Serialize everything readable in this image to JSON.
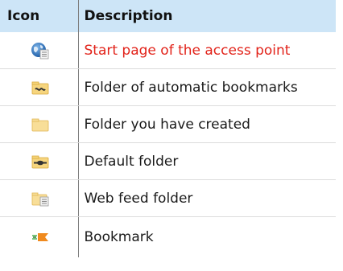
{
  "table": {
    "headers": {
      "icon": "Icon",
      "description": "Description"
    },
    "rows": [
      {
        "icon": "globe-document-icon",
        "description": "Start page of the access point",
        "highlight_color": "#e2231a"
      },
      {
        "icon": "folder-wave-icon",
        "description": "Folder of automatic bookmarks"
      },
      {
        "icon": "folder-icon",
        "description": "Folder you have created"
      },
      {
        "icon": "folder-default-icon",
        "description": "Default folder"
      },
      {
        "icon": "folder-document-icon",
        "description": "Web feed folder"
      },
      {
        "icon": "bookmark-tag-icon",
        "description": "Bookmark"
      }
    ]
  },
  "colors": {
    "header_background": "#cde5f7",
    "highlight_text": "#e2231a",
    "folder": "#f4d27a"
  }
}
